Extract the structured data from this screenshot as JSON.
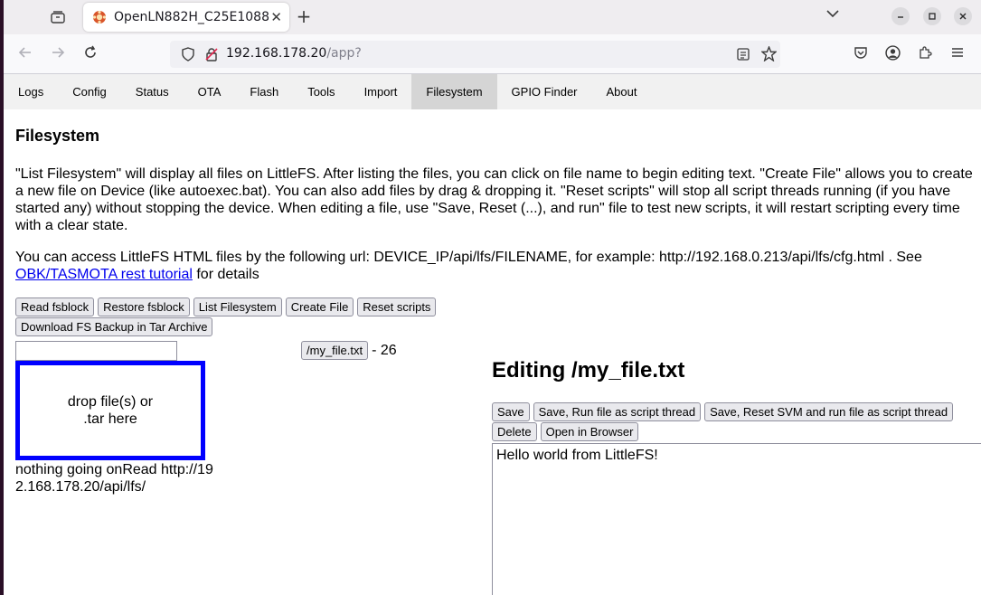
{
  "browser": {
    "tab_title": "OpenLN882H_C25E1088",
    "url_host": "192.168.178.20",
    "url_path": "/app?"
  },
  "menu": {
    "tabs": [
      {
        "label": "Logs"
      },
      {
        "label": "Config"
      },
      {
        "label": "Status"
      },
      {
        "label": "OTA"
      },
      {
        "label": "Flash"
      },
      {
        "label": "Tools"
      },
      {
        "label": "Import"
      },
      {
        "label": "Filesystem"
      },
      {
        "label": "GPIO Finder"
      },
      {
        "label": "About"
      }
    ],
    "active": "Filesystem"
  },
  "filesystem": {
    "heading": "Filesystem",
    "description": "\"List Filesystem\" will display all files on LittleFS. After listing the files, you can click on file name to begin editing text. \"Create File\" allows you to create a new file on Device (like autoexec.bat). You can also add files by drag & dropping it. \"Reset scripts\" will stop all script threads running (if you have started any) without stopping the device. When editing a file, use \"Save, Reset (...), and run\" file to test new scripts, it will restart scripting every time with a clear state.",
    "url_info_prefix": "You can access LittleFS HTML files by the following url: DEVICE_IP/api/lfs/FILENAME, for example: http://192.168.0.213/api/lfs/cfg.html . See ",
    "url_info_link": "OBK/TASMOTA rest tutorial",
    "url_info_suffix": " for details",
    "buttons": {
      "read_fsblock": "Read fsblock",
      "restore_fsblock": "Restore fsblock",
      "list_filesystem": "List Filesystem",
      "create_file": "Create File",
      "reset_scripts": "Reset scripts",
      "download_backup": "Download FS Backup in Tar Archive"
    },
    "new_file_value": "",
    "dropzone_text": "drop file(s) or .tar here",
    "status_text": "nothing going onRead http://192.168.178.20/api/lfs/",
    "files": [
      {
        "name": "/my_file.txt",
        "size": "- 26"
      }
    ]
  },
  "editor": {
    "title": "Editing /my_file.txt",
    "buttons": {
      "save": "Save",
      "save_run": "Save, Run file as script thread",
      "save_reset_run": "Save, Reset SVM and run file as script thread",
      "delete": "Delete",
      "open_browser": "Open in Browser"
    },
    "content": "Hello world from LittleFS!"
  }
}
